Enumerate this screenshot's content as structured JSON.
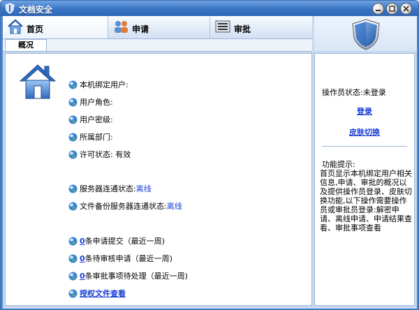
{
  "window": {
    "title": "文档安全"
  },
  "colors": {
    "link": "#1a3fd6",
    "titlebar": "#3a74c4",
    "panel_border": "#9fb6d8"
  },
  "tabs": [
    {
      "label": "首页",
      "icon": "home-icon"
    },
    {
      "label": "申请",
      "icon": "people-icon"
    },
    {
      "label": "审批",
      "icon": "list-icon"
    }
  ],
  "subtabs": [
    {
      "label": "概况"
    }
  ],
  "overview": {
    "user_info": [
      {
        "label": "本机绑定用户:"
      },
      {
        "label": "用户角色:"
      },
      {
        "label": "用户密级:"
      },
      {
        "label": "所属部门:"
      },
      {
        "label": "许可状态:",
        "value": "有效"
      }
    ],
    "servers": [
      {
        "label": "服务器连通状态:",
        "value": "离线"
      },
      {
        "label": "文件备份服务器连通状态:",
        "value": "离线"
      }
    ],
    "tasks": [
      {
        "count": "0",
        "label": "条申请提交（最近一周)"
      },
      {
        "count": "0",
        "label": "条待审核申请（最近一周)"
      },
      {
        "count": "0",
        "label": "条审批事项待处理（最近一周)"
      }
    ],
    "doc_link": "授权文件查看"
  },
  "sidebar": {
    "operator_status": "操作员状态:未登录",
    "login_link": "登录",
    "skin_link": "皮肤切换",
    "hint_title": "功能提示:",
    "hint_text": "首页显示本机绑定用户相关信息,申请、审批的概况以及提供操作员登录、皮肤切换功能,以下操作需要操作员或审批员登录:解密申请、离线申请、申请结果查看、审批事项查看"
  }
}
